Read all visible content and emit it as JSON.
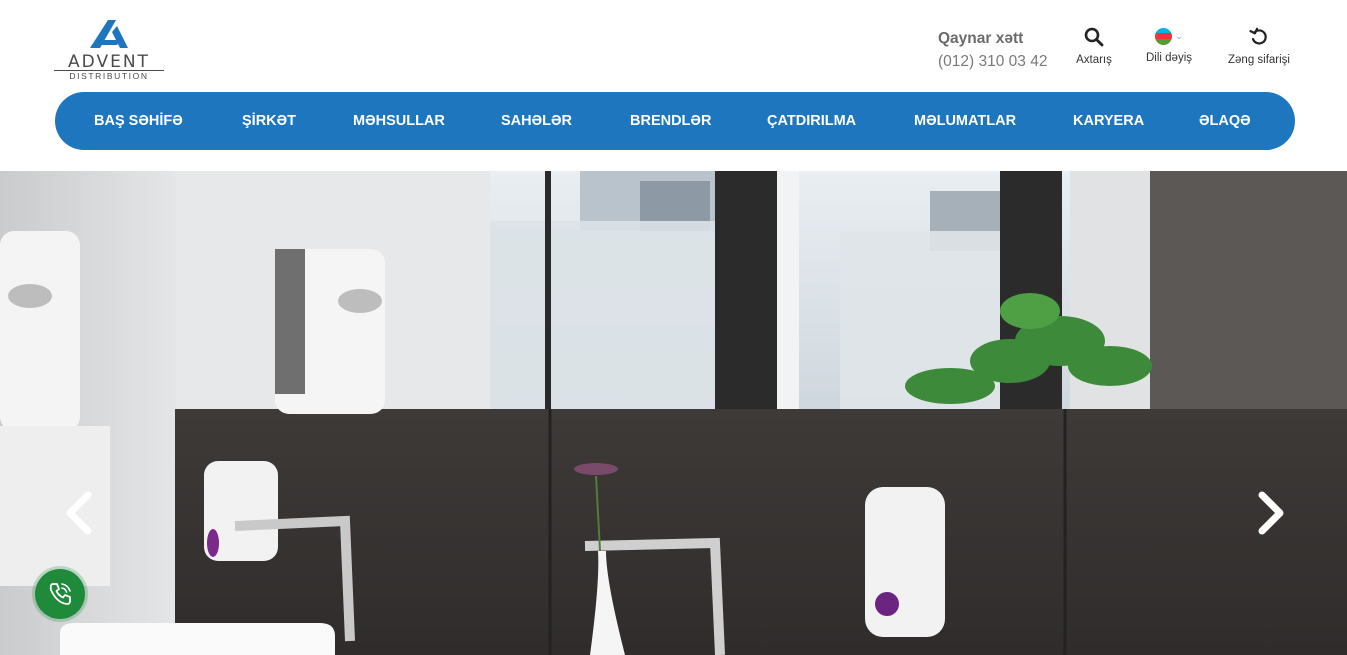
{
  "logo": {
    "name": "ADVENT",
    "sub": "DISTRIBUTION"
  },
  "hotline": {
    "label": "Qaynar xətt",
    "phone": "(012) 310 03 42"
  },
  "tools": {
    "search_label": "Axtarış",
    "language_label": "Dili dəyiş",
    "callback_label": "Zəng sifarişi"
  },
  "nav": {
    "items": [
      {
        "label": "BAŞ SƏHİFƏ"
      },
      {
        "label": "ŞİRKƏT"
      },
      {
        "label": "MƏHSULLAR"
      },
      {
        "label": "SAHƏLƏR"
      },
      {
        "label": "BRENDLƏR"
      },
      {
        "label": "ÇATDIRILMA"
      },
      {
        "label": "MƏLUMATLAR"
      },
      {
        "label": "KARYERA"
      },
      {
        "label": "ƏLAQƏ"
      }
    ]
  },
  "colors": {
    "brand_blue": "#1d76be",
    "call_green": "#1e8a3a",
    "text_gray": "#6b6b6b"
  },
  "icons": {
    "search": "search-icon",
    "language": "azerbaijan-flag-icon",
    "callback": "callback-icon",
    "prev": "chevron-left-icon",
    "next": "chevron-right-icon",
    "call": "phone-call-icon"
  }
}
